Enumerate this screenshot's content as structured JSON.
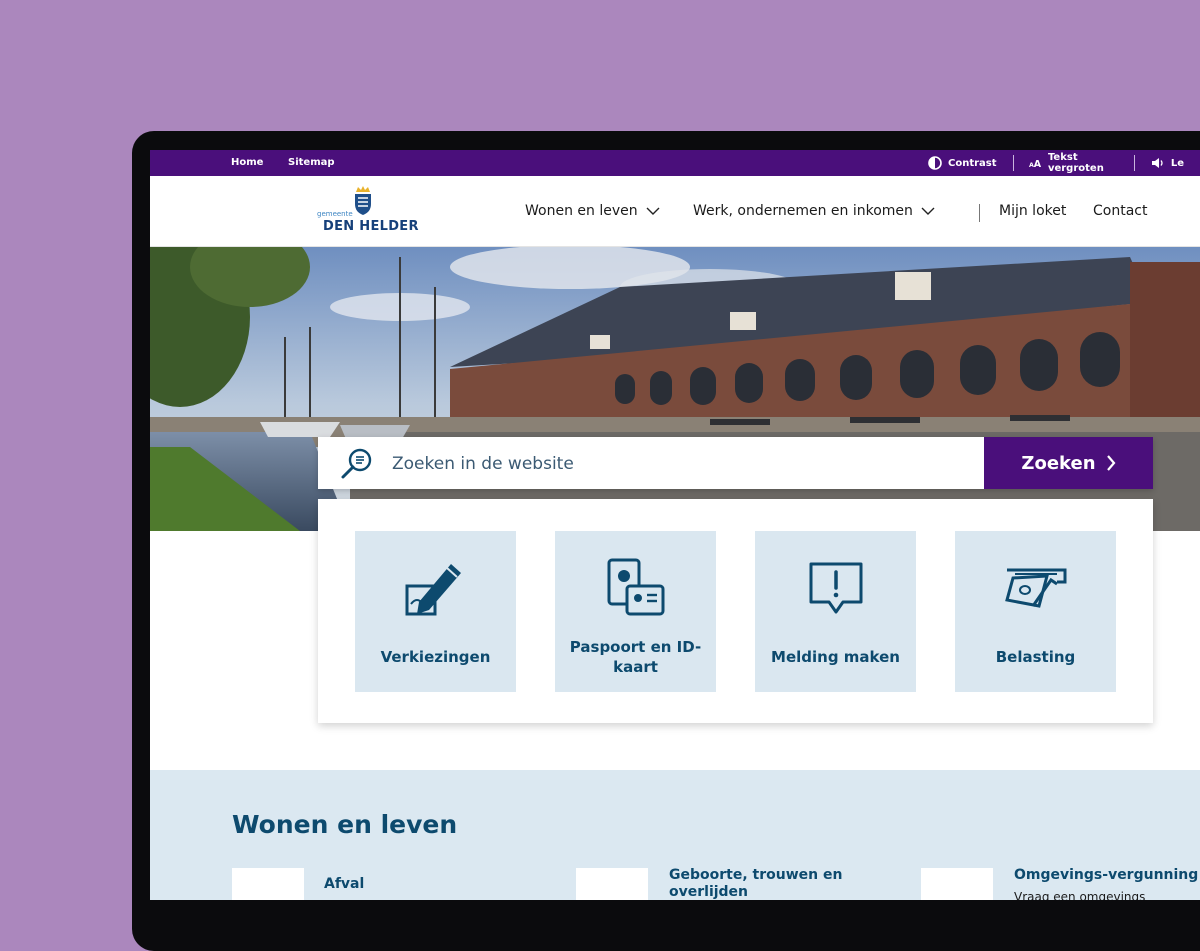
{
  "utility_bar": {
    "home": "Home",
    "sitemap": "Sitemap",
    "contrast": "Contrast",
    "text_enlarge": "Tekst vergroten",
    "read_aloud": "Le",
    "icons": [
      "contrast-icon",
      "text-size-icon",
      "speaker-icon"
    ]
  },
  "header": {
    "logo_small": "gemeente",
    "logo_main": "DEN HELDER",
    "nav": [
      {
        "label": "Wonen en leven",
        "has_dropdown": true
      },
      {
        "label": "Werk, ondernemen en inkomen",
        "has_dropdown": true
      },
      {
        "label": "Mijn loket",
        "has_dropdown": false
      },
      {
        "label": "Contact",
        "has_dropdown": false
      }
    ]
  },
  "search": {
    "placeholder": "Zoeken in de website",
    "button_label": "Zoeken"
  },
  "quick_tiles": [
    {
      "label": "Verkiezingen",
      "icon": "pencil-ballot-icon"
    },
    {
      "label": "Paspoort en ID-kaart",
      "icon": "passport-id-icon"
    },
    {
      "label": "Melding maken",
      "icon": "report-alert-icon"
    },
    {
      "label": "Belasting",
      "icon": "tax-money-icon"
    }
  ],
  "section": {
    "title": "Wonen en leven",
    "cards": [
      {
        "title": "Afval",
        "desc": ""
      },
      {
        "title": "Geboorte, trouwen en overlijden",
        "desc": ""
      },
      {
        "title": "Omgevings-vergunning",
        "desc": "Vraag een omgevings"
      }
    ]
  },
  "colors": {
    "background": "#ab87bd",
    "brand_purple": "#4a0f7b",
    "tile_bg": "#dae7f0",
    "text_blue": "#0d4a6e"
  }
}
